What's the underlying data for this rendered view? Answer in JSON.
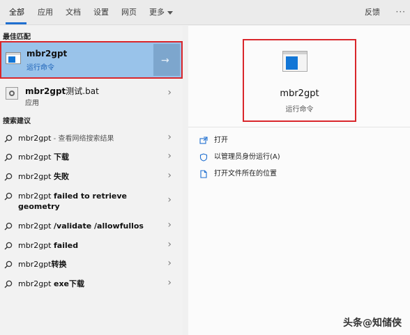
{
  "tabs": [
    {
      "label": "全部",
      "active": true
    },
    {
      "label": "应用"
    },
    {
      "label": "文档"
    },
    {
      "label": "设置"
    },
    {
      "label": "网页"
    },
    {
      "label": "更多"
    }
  ],
  "feedback_label": "反馈",
  "more_options": "···",
  "best_match": {
    "heading": "最佳匹配",
    "title": "mbr2gpt",
    "subtitle": "运行命令"
  },
  "app_result": {
    "title_bold": "mbr2gpt",
    "title_rest": "测试.bat",
    "subtitle": "应用"
  },
  "suggestions_heading": "搜索建议",
  "suggestions": [
    {
      "normal": "mbr2gpt",
      "bold": "",
      "hint": " - 查看网络搜索结果"
    },
    {
      "normal": "mbr2gpt ",
      "bold": "下载",
      "hint": ""
    },
    {
      "normal": "mbr2gpt ",
      "bold": "失败",
      "hint": ""
    },
    {
      "normal": "mbr2gpt ",
      "bold": "failed to retrieve geometry",
      "hint": ""
    },
    {
      "normal": "mbr2gpt ",
      "bold": "/validate /allowfullos",
      "hint": ""
    },
    {
      "normal": "mbr2gpt ",
      "bold": "failed",
      "hint": ""
    },
    {
      "normal": "mbr2gpt",
      "bold": "转换",
      "hint": ""
    },
    {
      "normal": "mbr2gpt ",
      "bold": "exe下载",
      "hint": ""
    }
  ],
  "preview": {
    "title": "mbr2gpt",
    "subtitle": "运行命令"
  },
  "actions": [
    {
      "label": "打开"
    },
    {
      "label": "以管理员身份运行(A)"
    },
    {
      "label": "打开文件所在的位置"
    }
  ],
  "watermark": "头条@知储侠",
  "colors": {
    "accent": "#1f6fd0",
    "selection": "#99c3ea",
    "highlight_border": "#d9262b",
    "command_blue": "#1276d6"
  }
}
